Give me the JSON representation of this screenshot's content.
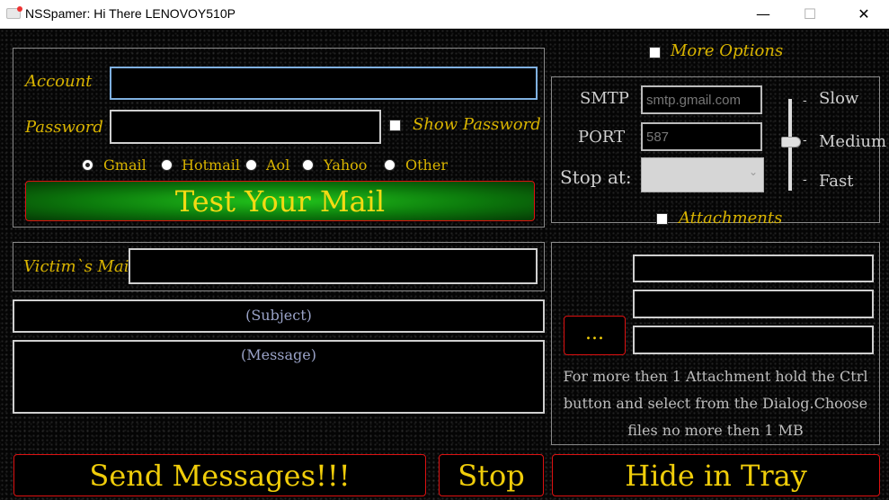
{
  "window": {
    "title": "NSSpamer: Hi There LENOVOY510P",
    "minimize_glyph": "—",
    "maximize_glyph": "☐",
    "close_glyph": "✕"
  },
  "account": {
    "account_label": "Account",
    "account_value": "",
    "password_label": "Password",
    "password_value": "",
    "show_password_label": "Show Password",
    "show_password_checked": false,
    "providers": [
      "Gmail",
      "Hotmail",
      "Aol",
      "Yahoo",
      "Other"
    ],
    "selected_provider": "Gmail",
    "test_button": "Test Your Mail"
  },
  "options": {
    "more_options_label": "More Options",
    "smtp_label": "SMTP",
    "smtp_value": "smtp.gmail.com",
    "port_label": "PORT",
    "port_value": "587",
    "stop_at_label": "Stop at:",
    "stop_at_value": "",
    "speed_ticks": [
      "Slow",
      "Medium",
      "Fast"
    ],
    "speed_selected": "Medium",
    "tick_mark": "-",
    "attachments_label": "Attachments"
  },
  "compose": {
    "victim_label": "Victim`s Mail",
    "victim_value": "",
    "subject_placeholder": "(Subject)",
    "message_placeholder": "(Message)"
  },
  "attachments": {
    "browse_button": "...",
    "files": [
      "",
      "",
      ""
    ],
    "hint": "For more then 1 Attachment hold the Ctrl button and select from the Dialog.Choose files no more then 1 MB"
  },
  "actions": {
    "send": "Send Messages!!!",
    "stop": "Stop",
    "hide": "Hide in Tray"
  },
  "colors": {
    "label_gold": "#d9b400",
    "button_border": "#dd1111",
    "background": "#000000"
  }
}
